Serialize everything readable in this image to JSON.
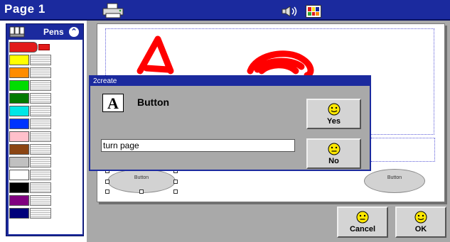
{
  "header": {
    "title": "Page 1"
  },
  "toolbar": {
    "print_icon": "printer-icon",
    "sound_icon": "speaker-icon",
    "palette_icon": "color-palette-icon",
    "palette_colors": [
      "#e21a1a",
      "#f7e21a",
      "#1b2a9e",
      "#2ea42e",
      "#e21a1a",
      "#ff8c00"
    ]
  },
  "pens": {
    "label": "Pens",
    "collapse_icon": "chevron-up-icon",
    "colors": [
      "#e21a1a",
      "#ffff00",
      "#ff8c00",
      "#00dd00",
      "#007a00",
      "#00e6e6",
      "#0033ff",
      "#ffc0cb",
      "#8b4513",
      "#c0c0c0",
      "#ffffff",
      "#000000",
      "#800080",
      "#00007a"
    ],
    "active_index": 0
  },
  "canvas": {
    "buttons": [
      {
        "label": "Button"
      },
      {
        "label": "Button"
      }
    ],
    "ink_color": "#ff0000"
  },
  "dialog": {
    "title": "2create",
    "type_icon_letter": "A",
    "type_label": "Button",
    "input_value": "turn page",
    "yes_label": "Yes",
    "no_label": "No"
  },
  "footer": {
    "cancel_label": "Cancel",
    "ok_label": "OK"
  },
  "colors": {
    "accent": "#1b2a9e",
    "workspace": "#a9a9a9",
    "smiley": "#ffe800"
  }
}
